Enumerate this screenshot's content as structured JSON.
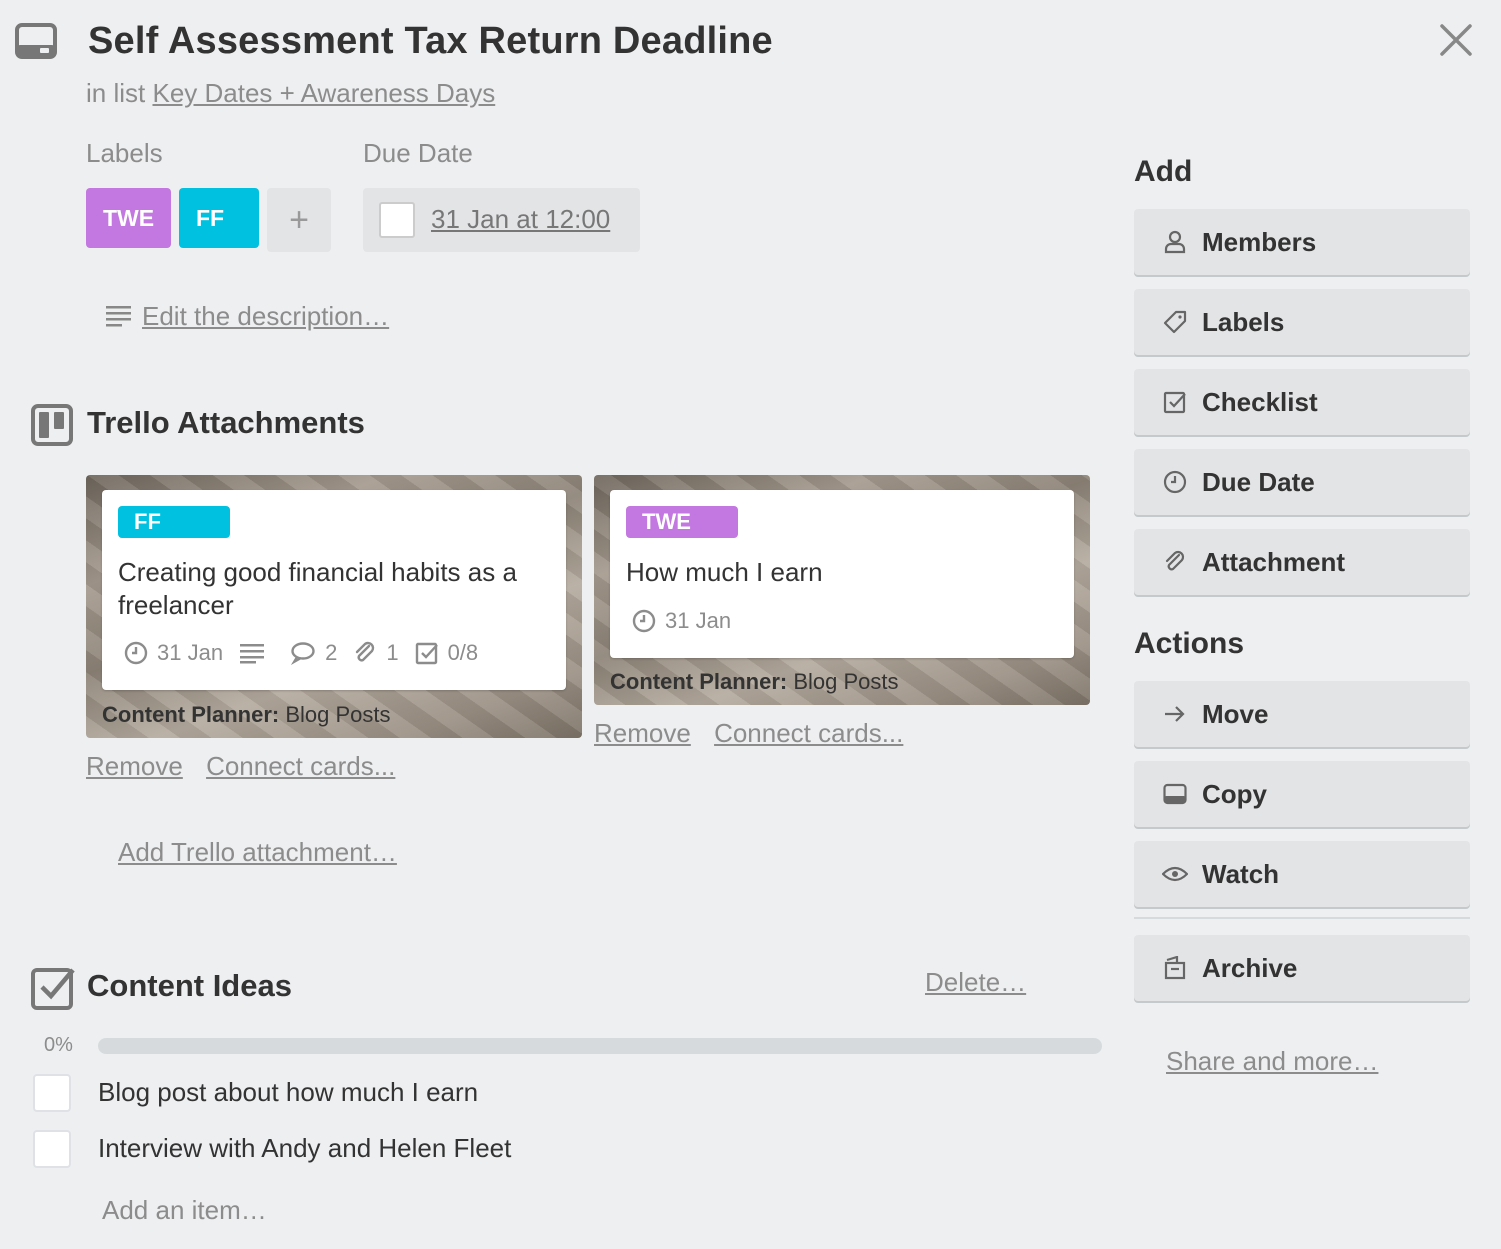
{
  "header": {
    "title": "Self Assessment Tax Return Deadline",
    "in_list_prefix": "in list",
    "list_name": "Key Dates + Awareness Days"
  },
  "labels": {
    "heading": "Labels",
    "items": [
      {
        "text": "TWE",
        "color": "#c377e0"
      },
      {
        "text": "FF",
        "color": "#00c2e0"
      }
    ],
    "add_symbol": "+"
  },
  "due_date": {
    "heading": "Due Date",
    "value": "31 Jan at 12:00"
  },
  "description": {
    "link": "Edit the description…"
  },
  "attachments": {
    "title": "Trello Attachments",
    "cards": [
      {
        "label": "FF",
        "label_color": "#00c2e0",
        "title_line1": "Creating good financial habits as a",
        "title_line2": "freelancer",
        "due": "31 Jan",
        "comments": "2",
        "attachments": "1",
        "checklist": "0/8",
        "board": "Content Planner:",
        "list": "Blog Posts"
      },
      {
        "label": "TWE",
        "label_color": "#c377e0",
        "title_line1": "How much I earn",
        "due": "31 Jan",
        "board": "Content Planner:",
        "list": "Blog Posts"
      }
    ],
    "remove_label": "Remove",
    "connect_label": "Connect cards...",
    "add_link": "Add Trello attachment…"
  },
  "checklist": {
    "title": "Content Ideas",
    "delete_label": "Delete…",
    "percent": "0%",
    "progress": 0,
    "items": [
      {
        "text": "Blog post about how much I earn",
        "checked": false
      },
      {
        "text": "Interview with Andy and Helen Fleet",
        "checked": false
      }
    ],
    "add_item": "Add an item…"
  },
  "sidebar": {
    "add_heading": "Add",
    "add_buttons": [
      {
        "label": "Members",
        "icon": "person-icon"
      },
      {
        "label": "Labels",
        "icon": "tag-icon"
      },
      {
        "label": "Checklist",
        "icon": "checkbox-icon"
      },
      {
        "label": "Due Date",
        "icon": "clock-icon"
      },
      {
        "label": "Attachment",
        "icon": "paperclip-icon"
      }
    ],
    "actions_heading": "Actions",
    "action_buttons": [
      {
        "label": "Move",
        "icon": "arrow-right-icon"
      },
      {
        "label": "Copy",
        "icon": "card-icon"
      },
      {
        "label": "Watch",
        "icon": "eye-icon"
      },
      {
        "label": "Archive",
        "icon": "archive-icon"
      }
    ],
    "share_link": "Share and more…"
  },
  "colors": {
    "background": "#edeff1",
    "button": "#e2e4e6",
    "label_purple": "#c377e0",
    "label_cyan": "#00c2e0"
  }
}
